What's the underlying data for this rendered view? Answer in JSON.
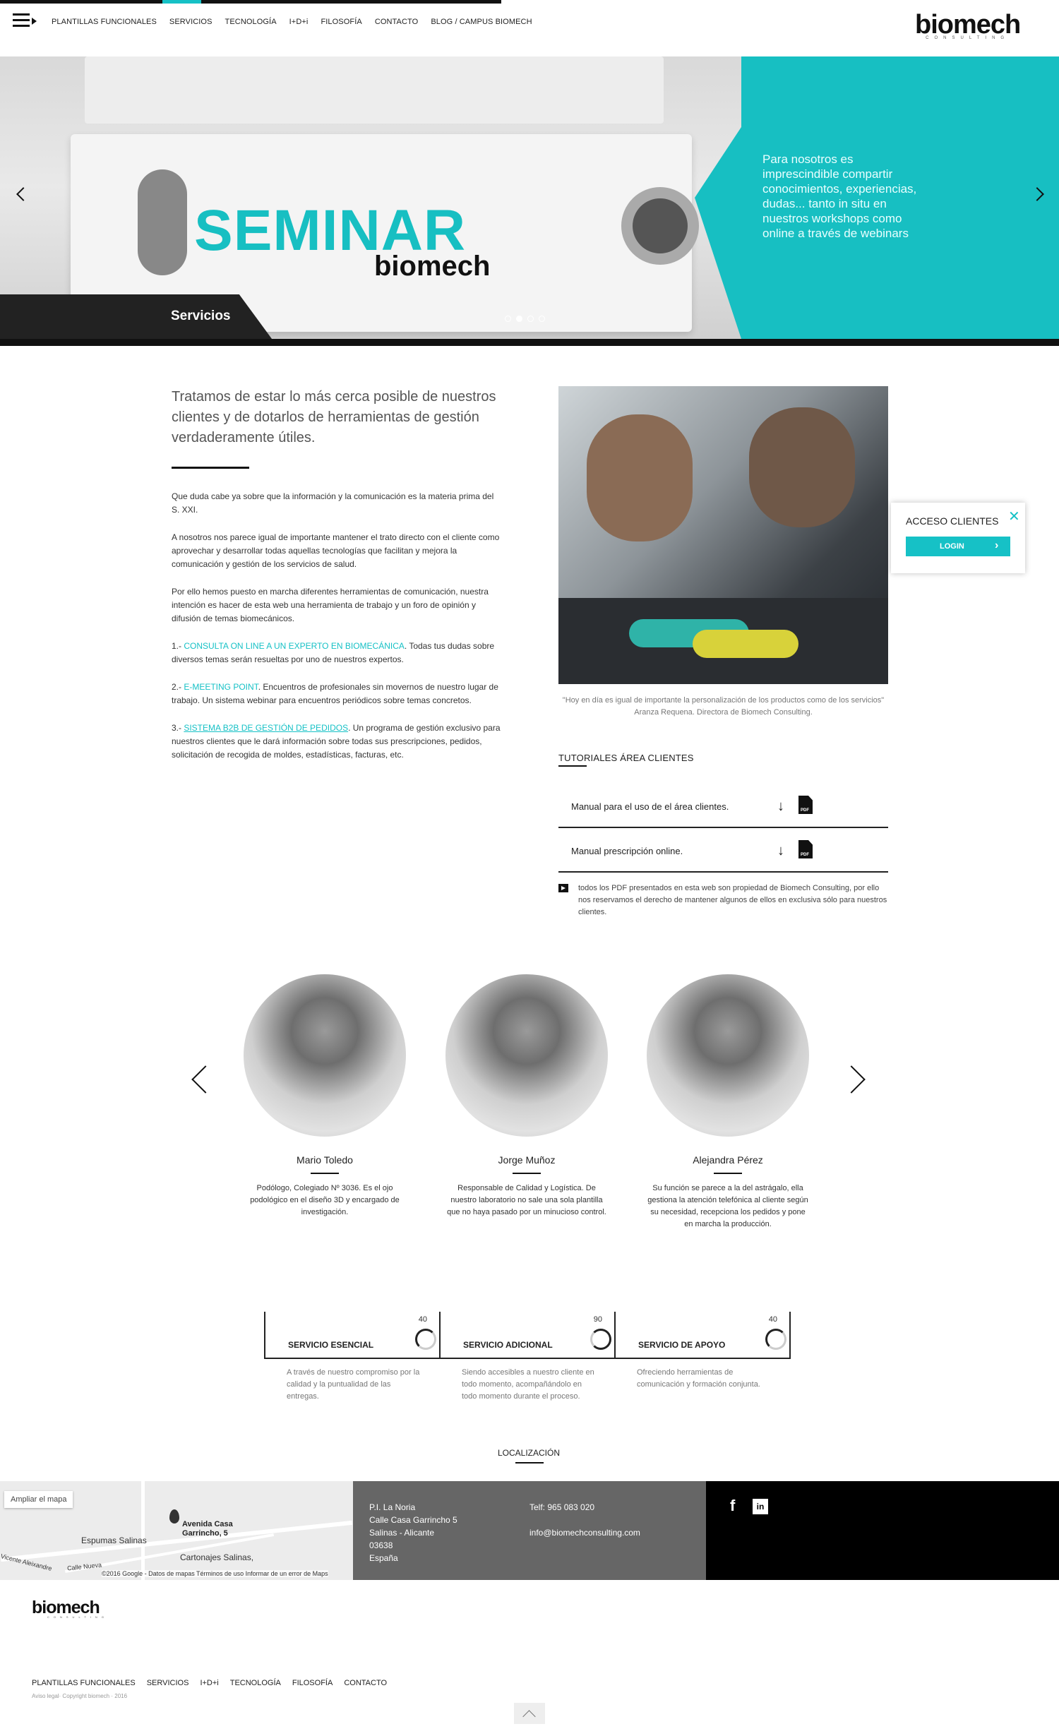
{
  "header": {
    "nav": [
      "PLANTILLAS FUNCIONALES",
      "SERVICIOS",
      "TECNOLOGÍA",
      "I+D+i",
      "FILOSOFÍA",
      "CONTACTO",
      "BLOG / CAMPUS BIOMECH"
    ],
    "logo_word": "biomech",
    "logo_sub": "CONSULTING"
  },
  "hero": {
    "image_title": "SEMINAR",
    "image_brand": "biomech",
    "panel_text": "Para nosotros es imprescindible compartir conocimientos, experiencias, dudas... tanto in situ en nuestros workshops como online a través de webinars",
    "caption": "Servicios",
    "active_slide": 2,
    "slide_count": 4,
    "accent_color": "#16c1c6"
  },
  "intro": {
    "lead": "Tratamos de estar lo más cerca posible de nuestros clientes y de dotarlos de herramientas de gestión verdaderamente útiles.",
    "p1": "Que duda cabe ya sobre que la información y la comunicación es la materia prima del S. XXI.",
    "p2": "A nosotros nos parece igual de importante mantener el trato directo con el cliente como aprovechar y desarrollar todas aquellas tecnologías que facilitan y mejora la comunicación y gestión de los servicios de salud.",
    "p3": "Por ello hemos puesto en marcha diferentes herramientas de comunicación, nuestra intención es hacer de esta web una herramienta de trabajo y un foro de opinión y difusión de temas biomecánicos.",
    "item1_num": "1.- ",
    "item1_link": "CONSULTA ON LINE A UN EXPERTO EN BIOMECÁNICA",
    "item1_text": ". Todas tus dudas sobre diversos temas serán resueltas por uno de nuestros expertos.",
    "item2_num": "2.- ",
    "item2_link": "E-MEETING POINT",
    "item2_text": ". Encuentros de profesionales sin movernos de nuestro lugar de trabajo. Un sistema webinar para encuentros periódicos sobre temas concretos.",
    "item3_num": "3.- ",
    "item3_link": "SISTEMA B2B DE GESTIÓN DE PEDIDOS",
    "item3_text": ". Un programa de gestión exclusivo para nuestros clientes que le dará información sobre todas sus prescripciones, pedidos, solicitación de recogida de moldes, estadísticas, facturas, etc."
  },
  "quote": {
    "text": "\"Hoy en día es igual de importante la personalización de los productos como de los servicios\"",
    "author": "Aranza Requena. Directora de Biomech Consulting."
  },
  "tutorials": {
    "title": "TUTORIALES ÁREA CLIENTES",
    "items": [
      {
        "label": "Manual para el uso de el área clientes.",
        "pdf": "PDF",
        "arrow": "↓"
      },
      {
        "label": "Manual prescripción online.",
        "pdf": "PDF",
        "arrow": "↓"
      }
    ],
    "note": "todos los PDF presentados en esta web son propiedad de Biomech Consulting, por ello nos reservamos el derecho de mantener algunos de ellos en exclusiva sólo para nuestros clientes."
  },
  "login_popup": {
    "title": "ACCESO CLIENTES",
    "close": "✕",
    "button": "LOGIN",
    "button_arrow": "›"
  },
  "team": [
    {
      "name": "Mario Toledo",
      "desc": "Podólogo, Colegiado Nº 3036. Es el ojo podológico en el diseño 3D y encargado de investigación."
    },
    {
      "name": "Jorge Muñoz",
      "desc": "Responsable de Calidad y Logística. De nuestro laboratorio no sale una sola plantilla que no haya pasado por un minucioso control."
    },
    {
      "name": "Alejandra Pérez",
      "desc": "Su función se parece a la del astrágalo, ella gestiona la atención telefónica al cliente según su necesidad, recepciona los pedidos y pone en marcha la producción."
    }
  ],
  "services": [
    {
      "label": "SERVICIO ESENCIAL",
      "value": "40",
      "desc": "A través de nuestro compromiso por la calidad y la puntualidad de las entregas."
    },
    {
      "label": "SERVICIO ADICIONAL",
      "value": "90",
      "desc": "Siendo accesibles a nuestro cliente en todo momento, acompañándolo en todo momento durante el proceso."
    },
    {
      "label": "SERVICIO DE APOYO",
      "value": "40",
      "desc": "Ofreciendo herramientas de comunicación y formación conjunta."
    }
  ],
  "location": {
    "title": "LOCALIZACIÓN",
    "map_button": "Ampliar el mapa",
    "map_pin_label": "Avenida Casa Garrincho, 5",
    "map_labels": [
      "Espumas Salinas",
      "Cartonajes Salinas,",
      "Calle Nueva",
      "Vicente Aleixandre"
    ],
    "map_footer": "©2016 Google - Datos de mapas   Términos de uso   Informar de un error de Maps",
    "address_lines": [
      "P.I. La Noria",
      "Calle Casa Garrincho 5",
      "Salinas - Alicante",
      "03638",
      "España"
    ],
    "phone": "Telf: 965 083 020",
    "email": "info@biomechconsulting.com",
    "facebook_icon": "f",
    "linkedin_icon": "in"
  },
  "footer": {
    "logo_word": "biomech",
    "logo_sub": "CONSULTING",
    "nav": [
      "PLANTILLAS FUNCIONALES",
      "SERVICIOS",
      "I+D+i",
      "TECNOLOGÍA",
      "FILOSOFÍA",
      "CONTACTO"
    ],
    "copyright": "Aviso legal· Copyright biomech · 2016"
  }
}
